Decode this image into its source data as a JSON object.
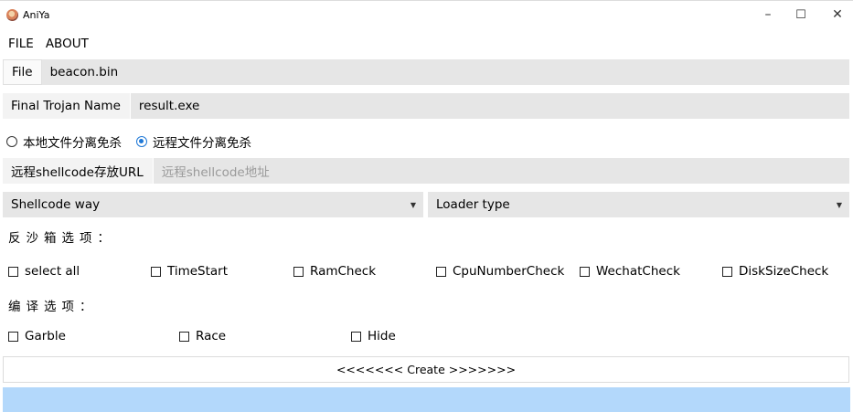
{
  "window": {
    "title": "AniYa",
    "controls": {
      "minimize": "–",
      "maximize": "☐",
      "close": "✕"
    }
  },
  "menu": [
    {
      "label": "FILE"
    },
    {
      "label": "ABOUT"
    }
  ],
  "file_row": {
    "label": "File",
    "value": "beacon.bin"
  },
  "trojan_row": {
    "label": "Final Trojan Name",
    "value": "result.exe"
  },
  "separation_modes": [
    {
      "label": "本地文件分离免杀",
      "selected": false
    },
    {
      "label": "远程文件分离免杀",
      "selected": true
    }
  ],
  "url_row": {
    "label": "远程shellcode存放URL",
    "placeholder": "远程shellcode地址"
  },
  "shellcode_select": {
    "label": "Shellcode way"
  },
  "loader_select": {
    "label": "Loader type"
  },
  "sandbox_section": {
    "title": "反沙箱选项：",
    "options": [
      {
        "label": "select all",
        "checked": false
      },
      {
        "label": "TimeStart",
        "checked": false
      },
      {
        "label": "RamCheck",
        "checked": false
      },
      {
        "label": "CpuNumberCheck",
        "checked": false
      },
      {
        "label": "WechatCheck",
        "checked": false
      },
      {
        "label": "DiskSizeCheck",
        "checked": false
      }
    ]
  },
  "compile_section": {
    "title": "编译选项：",
    "options": [
      {
        "label": "Garble",
        "checked": false
      },
      {
        "label": "Race",
        "checked": false
      },
      {
        "label": "Hide",
        "checked": false
      }
    ]
  },
  "create_button": {
    "label": "<<<<<<< Create >>>>>>>"
  },
  "colors": {
    "accent": "#1e78d7",
    "field_bg": "#e6e6e6",
    "status_bar": "#b3d8fb"
  }
}
